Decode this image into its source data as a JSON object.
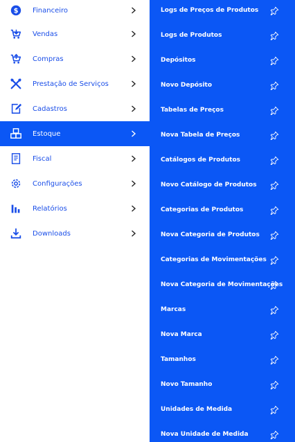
{
  "menu": {
    "items": [
      {
        "label": "Financeiro",
        "icon": "dollar-circle-icon"
      },
      {
        "label": "Vendas",
        "icon": "cart-icon"
      },
      {
        "label": "Compras",
        "icon": "cart-icon"
      },
      {
        "label": "Prestação de Serviços",
        "icon": "tools-icon"
      },
      {
        "label": "Cadastros",
        "icon": "edit-icon"
      },
      {
        "label": "Estoque",
        "icon": "boxes-icon",
        "active": true
      },
      {
        "label": "Fiscal",
        "icon": "invoice-icon"
      },
      {
        "label": "Configurações",
        "icon": "gear-icon"
      },
      {
        "label": "Relatórios",
        "icon": "bar-chart-icon"
      },
      {
        "label": "Downloads",
        "icon": "download-icon"
      }
    ]
  },
  "submenu": {
    "items": [
      {
        "label": "Logs de Preços de Produtos"
      },
      {
        "label": "Logs de Produtos"
      },
      {
        "label": "Depósitos"
      },
      {
        "label": "Novo Depósito"
      },
      {
        "label": "Tabelas de Preços"
      },
      {
        "label": "Nova Tabela de Preços"
      },
      {
        "label": "Catálogos de Produtos"
      },
      {
        "label": "Novo Catálogo de Produtos"
      },
      {
        "label": "Categorias de Produtos"
      },
      {
        "label": "Nova Categoria de Produtos"
      },
      {
        "label": "Categorias de Movimentações"
      },
      {
        "label": "Nova Categoria de Movimentações"
      },
      {
        "label": "Marcas"
      },
      {
        "label": "Nova Marca"
      },
      {
        "label": "Tamanhos"
      },
      {
        "label": "Novo Tamanho"
      },
      {
        "label": "Unidades de Medida"
      },
      {
        "label": "Nova Unidade de Medida"
      }
    ]
  },
  "colors": {
    "accent": "#0b57f5",
    "menu_text": "#1a4ee8",
    "background": "#ffffff"
  }
}
